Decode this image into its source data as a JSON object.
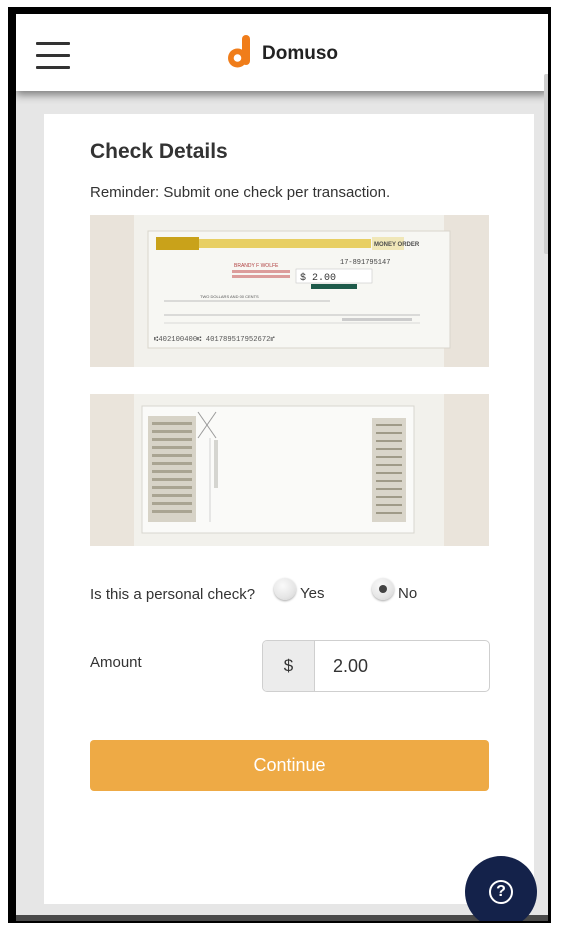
{
  "header": {
    "brand_name": "Domuso",
    "menu_icon": "hamburger-menu-icon",
    "logo_icon": "domuso-logo-icon",
    "brand_color": "#f07d1a"
  },
  "card": {
    "title": "Check Details",
    "reminder": "Reminder: Submit one check per transaction.",
    "check_front": {
      "payee_name": "BRANDY F WOLFE",
      "serial": "17-891795147",
      "amount": "$ 2.00",
      "pay_line": "TWO DOLLARS AND 00 CENTS",
      "micr": "⑆402100400⑆ 401789517952672⑈",
      "banner": "MONEY ORDER"
    },
    "personal_check": {
      "question": "Is this a personal check?",
      "options": [
        {
          "label": "Yes",
          "selected": false
        },
        {
          "label": "No",
          "selected": true
        }
      ]
    },
    "amount": {
      "label": "Amount",
      "currency": "$",
      "value": "2.00"
    },
    "continue_label": "Continue"
  },
  "help": {
    "icon": "question-help-icon",
    "glyph": "?"
  },
  "colors": {
    "accent": "#eeaa45",
    "help_button": "#14224a",
    "background": "#e6e6e6"
  }
}
